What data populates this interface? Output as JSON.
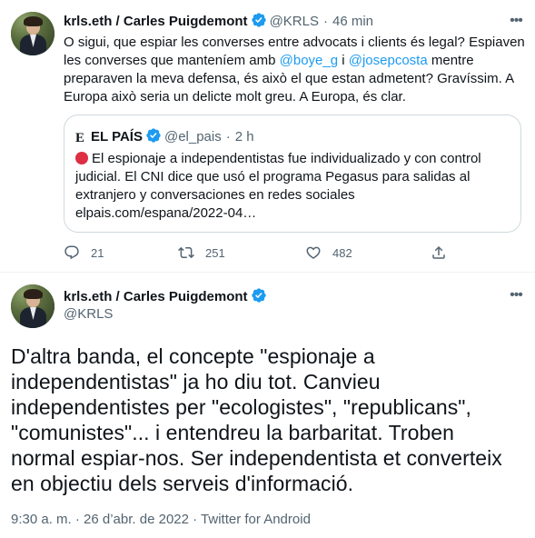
{
  "tweet1": {
    "name": "krls.eth / Carles Puigdemont",
    "handle": "@KRLS",
    "separator": "·",
    "time": "46 min",
    "text_lines": [
      "O sigui, que espiar les converses entre advocats i clients és legal? Espiaven",
      "les converses que mantení­em amb",
      "preparaven la meva defensa, és això el que estan admetent? Gravíssim. A",
      "Europa això seria un delicte molt greu. A Europa, és clar."
    ],
    "mention1": "@boye_g",
    "connector": " i ",
    "mention2": "@josepcosta",
    "line2_tail": " mentre",
    "quote": {
      "logo": "E",
      "name": "EL PAÍS",
      "handle": "@el_pais",
      "separator": "·",
      "time": "2 h",
      "text_lines": [
        "El espionaje a independentistas fue individualizado y con control",
        "judicial. El CNI dice que usó el programa Pegasus para salidas al",
        "extranjero y conversaciones en redes sociales",
        "elpais.com/espana/2022-04…"
      ]
    },
    "actions": {
      "replies": "21",
      "retweets": "251",
      "likes": "482"
    }
  },
  "tweet2": {
    "name": "krls.eth / Carles Puigdemont",
    "handle": "@KRLS",
    "text_lines": [
      "D'altra banda, el concepte \"espionaje a",
      "independentistas\" ja ho diu tot. Canvieu",
      "independentistes per \"ecologistes\", \"republicans\",",
      "\"comunistes\"... i entendreu la barbaritat. Troben",
      "normal espiar-nos. Ser independentista et converteix",
      "en objectiu dels serveis d'informació."
    ],
    "footer": "9:30 a. m. · 26 d’abr. de 2022 · Twitter for Android"
  },
  "colors": {
    "accent": "#1d9bf0",
    "muted": "#536471",
    "border": "#cfd9de",
    "red_dot": "#dd2e44"
  },
  "icons": [
    "verified-badge-icon",
    "more-icon",
    "reply-icon",
    "retweet-icon",
    "like-icon",
    "share-icon",
    "red-circle-emoji-icon",
    "el-pais-logo-icon"
  ]
}
